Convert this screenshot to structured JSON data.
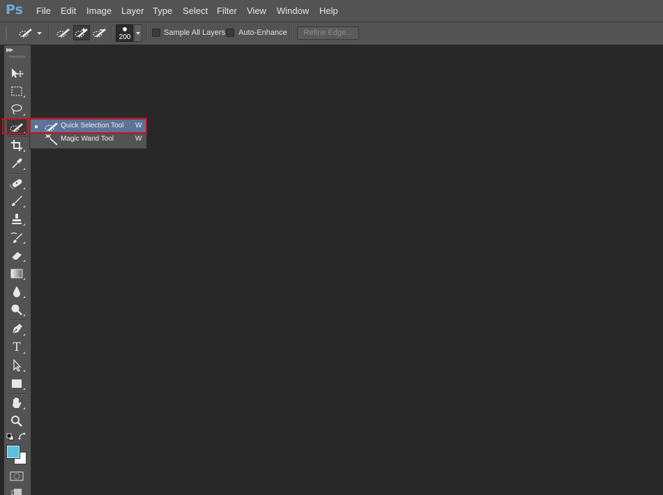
{
  "app": {
    "logo": "Ps",
    "menus": [
      "File",
      "Edit",
      "Image",
      "Layer",
      "Type",
      "Select",
      "Filter",
      "View",
      "Window",
      "Help"
    ]
  },
  "options": {
    "brush_size": "200",
    "sample_all_layers": {
      "label": "Sample All Layers",
      "checked": false
    },
    "auto_enhance": {
      "label": "Auto-Enhance",
      "checked": false
    },
    "refine_edge_label": "Refine Edge..."
  },
  "toolbar": {
    "tools": [
      {
        "name": "move-tool",
        "icon": "move-icon"
      },
      {
        "name": "rectangular-marquee-tool",
        "icon": "marquee-icon"
      },
      {
        "name": "lasso-tool",
        "icon": "lasso-icon"
      },
      {
        "name": "quick-selection-tool",
        "icon": "quick-selection-icon",
        "active": true
      },
      {
        "name": "crop-tool",
        "icon": "crop-icon"
      },
      {
        "name": "eyedropper-tool",
        "icon": "eyedropper-icon"
      },
      {
        "name": "spot-healing-brush-tool",
        "icon": "bandage-icon"
      },
      {
        "name": "brush-tool",
        "icon": "brush-icon"
      },
      {
        "name": "clone-stamp-tool",
        "icon": "stamp-icon"
      },
      {
        "name": "history-brush-tool",
        "icon": "history-brush-icon"
      },
      {
        "name": "eraser-tool",
        "icon": "eraser-icon"
      },
      {
        "name": "gradient-tool",
        "icon": "gradient-icon"
      },
      {
        "name": "blur-tool",
        "icon": "drop-icon"
      },
      {
        "name": "dodge-tool",
        "icon": "dodge-icon"
      },
      {
        "name": "pen-tool",
        "icon": "pen-icon"
      },
      {
        "name": "type-tool",
        "icon": "type-icon",
        "glyph": "T"
      },
      {
        "name": "path-selection-tool",
        "icon": "arrow-icon"
      },
      {
        "name": "rectangle-tool",
        "icon": "rectangle-icon"
      },
      {
        "name": "hand-tool",
        "icon": "hand-icon"
      },
      {
        "name": "zoom-tool",
        "icon": "zoom-icon"
      }
    ],
    "foreground_color": "#5bc0de",
    "background_color": "#ffffff"
  },
  "flyout": {
    "items": [
      {
        "label": "Quick Selection Tool",
        "shortcut": "W",
        "selected": true
      },
      {
        "label": "Magic Wand Tool",
        "shortcut": "W",
        "selected": false
      }
    ]
  },
  "colors": {
    "accent_selection": "#5d7397",
    "highlight_box": "#c3121c"
  }
}
